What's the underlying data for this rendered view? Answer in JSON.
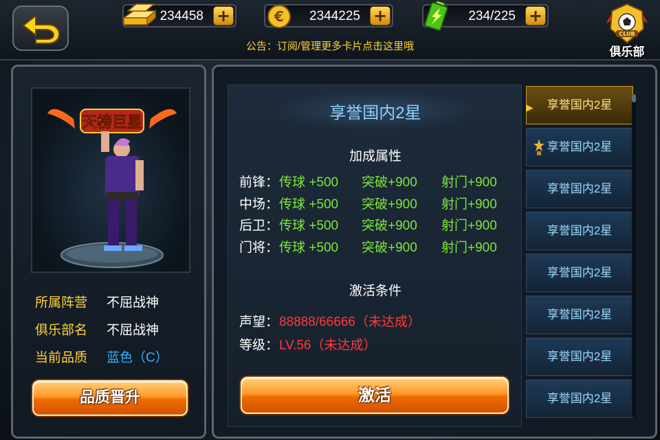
{
  "topbar": {
    "gold": "234458",
    "euro": "2344225",
    "energy": "234/225",
    "plus_label": "+",
    "notice": "公告：订阅/管理更多卡片点击这里哦",
    "club_label": "俱乐部",
    "club_badge_text": "CLUB"
  },
  "player": {
    "title_badge": "天榜巨星",
    "info": [
      {
        "key": "所属阵营",
        "value": "不屈战神"
      },
      {
        "key": "俱乐部名",
        "value": "不屈战神"
      },
      {
        "key": "当前品质",
        "value": "蓝色（C）"
      }
    ],
    "upgrade_button": "品质晋升"
  },
  "detail": {
    "title": "享誉国内2星",
    "bonus_heading": "加成属性",
    "bonus_rows": [
      {
        "position": "前锋：",
        "a1": "传球 +500",
        "a2": "突破+900",
        "a3": "射门+900"
      },
      {
        "position": "中场：",
        "a1": "传球 +500",
        "a2": "突破+900",
        "a3": "射门+900"
      },
      {
        "position": "后卫：",
        "a1": "传球 +500",
        "a2": "突破+900",
        "a3": "射门+900"
      },
      {
        "position": "门将：",
        "a1": "传球 +500",
        "a2": "突破+900",
        "a3": "射门+900"
      }
    ],
    "condition_heading": "激活条件",
    "conditions": [
      {
        "key": "声望：",
        "value": "88888/66666（未达成）"
      },
      {
        "key": "等级：",
        "value": "LV.56（未达成）"
      }
    ],
    "activate_button": "激活"
  },
  "list": {
    "items": [
      {
        "label": "享誉国内2星"
      },
      {
        "label": "享誉国内2星"
      },
      {
        "label": "享誉国内2星"
      },
      {
        "label": "享誉国内2星"
      },
      {
        "label": "享誉国内2星"
      },
      {
        "label": "享誉国内2星"
      },
      {
        "label": "享誉国内2星"
      },
      {
        "label": "享誉国内2星"
      }
    ]
  },
  "colors": {
    "accent_gold": "#ffd33a",
    "attr_green": "#7de83a",
    "warn_red": "#ff3a3a",
    "title_blue": "#8fd2ff"
  }
}
